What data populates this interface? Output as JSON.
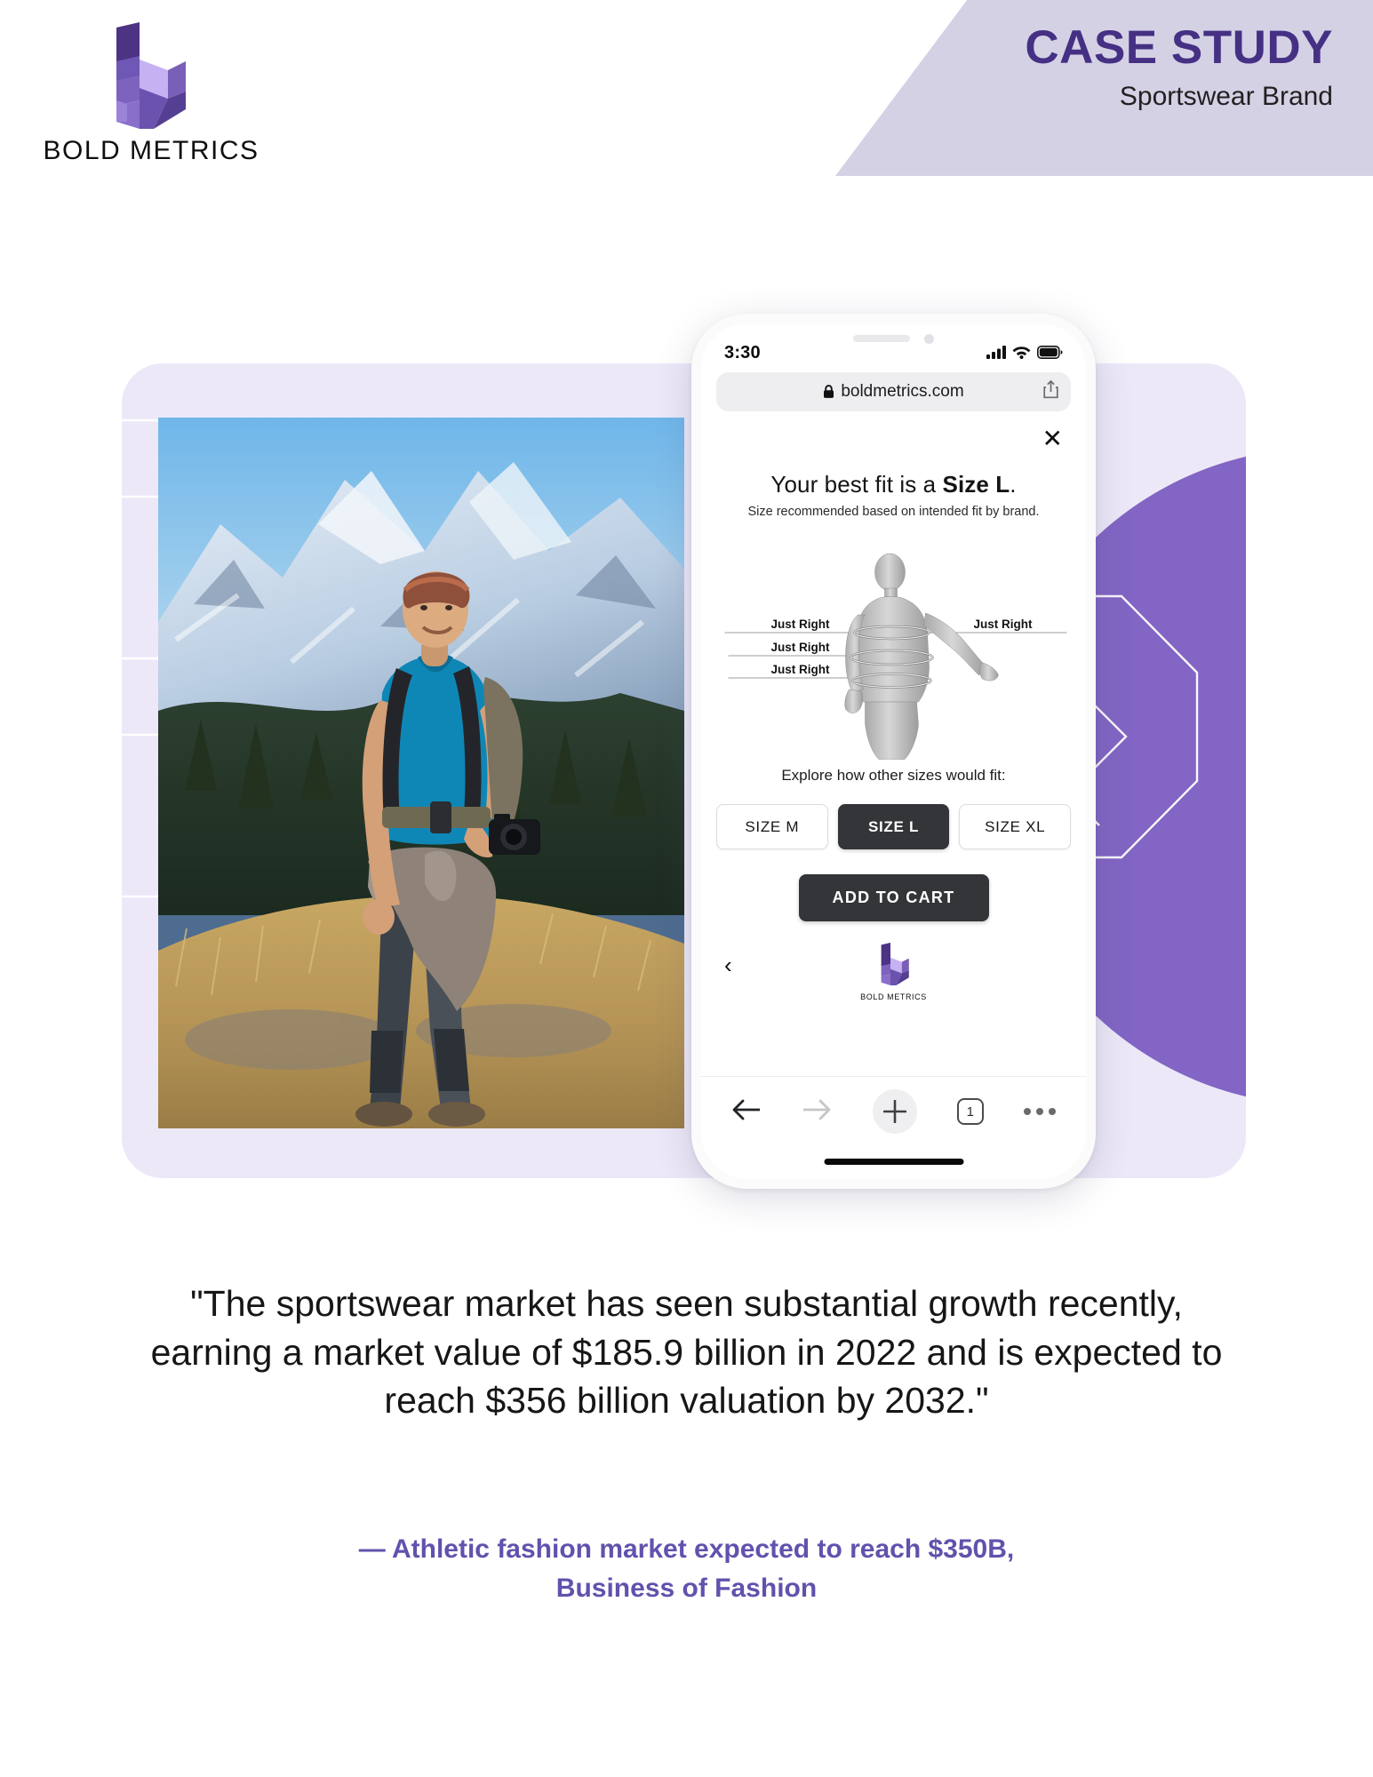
{
  "header": {
    "title": "CASE STUDY",
    "subtitle": "Sportswear Brand",
    "banner_color": "#d5d1e5",
    "title_color": "#453084"
  },
  "brand": {
    "name": "BOLD METRICS",
    "logo_icon": "bold-metrics-b-logo",
    "colors": {
      "dark_purple": "#4d3384",
      "mid_purple": "#6b4fa8",
      "light_purple": "#c9b8f0",
      "pale_purple": "#a98fd8"
    }
  },
  "backdrop": {
    "card_color": "#ece8f8",
    "circle_color": "#8265c4"
  },
  "hero_photo": {
    "alt": "Male hiker in teal t-shirt with backpack and camera standing on a grassy alpine ridge with snow-covered mountains behind"
  },
  "phone": {
    "status": {
      "time": "3:30",
      "signal_icon": "cellular-signal-icon",
      "wifi_icon": "wifi-icon",
      "battery_icon": "battery-full-icon"
    },
    "url_bar": {
      "lock_icon": "lock-icon",
      "url": "boldmetrics.com",
      "share_icon": "share-icon"
    },
    "page": {
      "close_label": "✕",
      "headline_prefix": "Your best fit is a ",
      "headline_size": "Size L",
      "headline_suffix": ".",
      "subhead": "Size recommended based on intended fit by brand.",
      "avatar_icon": "body-avatar-3d",
      "fit_labels": [
        {
          "label": "Just Right",
          "position": "left-chest"
        },
        {
          "label": "Just Right",
          "position": "left-waist"
        },
        {
          "label": "Just Right",
          "position": "left-hip"
        },
        {
          "label": "Just Right",
          "position": "right-sleeve"
        }
      ],
      "explore_label": "Explore how other sizes would fit:",
      "sizes": [
        {
          "label": "SIZE M",
          "selected": false
        },
        {
          "label": "SIZE L",
          "selected": true
        },
        {
          "label": "SIZE XL",
          "selected": false
        }
      ],
      "cart_label": "ADD TO CART",
      "back_chevron": "‹",
      "footer_brand": "BOLD METRICS"
    },
    "browser_toolbar": {
      "back_icon": "arrow-left-icon",
      "forward_icon": "arrow-right-icon",
      "new_tab_icon": "plus-icon",
      "tab_count": "1",
      "more_icon": "ellipsis-icon"
    }
  },
  "quote": {
    "line1": "\"The sportswear market has seen substantial growth recently,",
    "line2": "earning a market value of $185.9 billion in 2022 and is expected to",
    "line3": "reach $356 billion valuation by 2032.\""
  },
  "attribution": {
    "line1": "— Athletic fashion market expected to reach $350B,",
    "line2": "Business of Fashion",
    "color": "#6251ad"
  }
}
